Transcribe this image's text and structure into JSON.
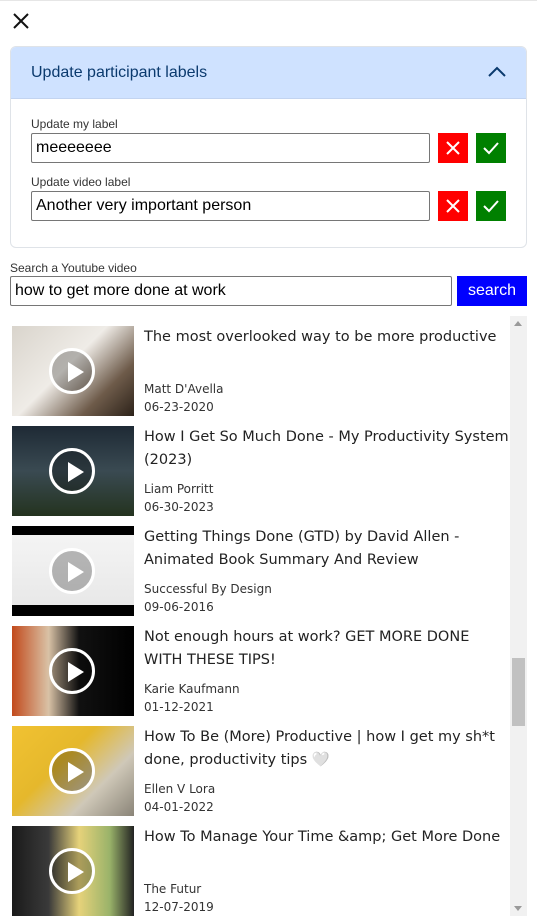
{
  "panel": {
    "title": "Update participant labels",
    "my_label": {
      "label": "Update my label",
      "value": "meeeeeee"
    },
    "video_label": {
      "label": "Update video label",
      "value": "Another very important person"
    }
  },
  "search": {
    "label": "Search a Youtube video",
    "value": "how to get more done at work",
    "button": "search"
  },
  "results": [
    {
      "title": "The most overlooked way to be more productive",
      "channel": "Matt D'Avella",
      "date": "06-23-2020"
    },
    {
      "title": "How I Get So Much Done - My Productivity System (2023)",
      "channel": "Liam Porritt",
      "date": "06-30-2023"
    },
    {
      "title": "Getting Things Done (GTD) by David Allen - Animated Book Summary And Review",
      "channel": "Successful By Design",
      "date": "09-06-2016"
    },
    {
      "title": "Not enough hours at work? GET MORE DONE WITH THESE TIPS!",
      "channel": "Karie Kaufmann",
      "date": "01-12-2021"
    },
    {
      "title": "How To Be (More) Productive | how I get my sh*t done, productivity tips 🤍",
      "channel": "Ellen V Lora",
      "date": "04-01-2022"
    },
    {
      "title": "How To Manage Your Time &amp; Get More Done",
      "channel": "The Futur",
      "date": "12-07-2019"
    }
  ],
  "colors": {
    "panel_header": "#cfe2ff",
    "cancel": "#ff0000",
    "confirm": "#008000",
    "search_button": "#0000ff"
  }
}
